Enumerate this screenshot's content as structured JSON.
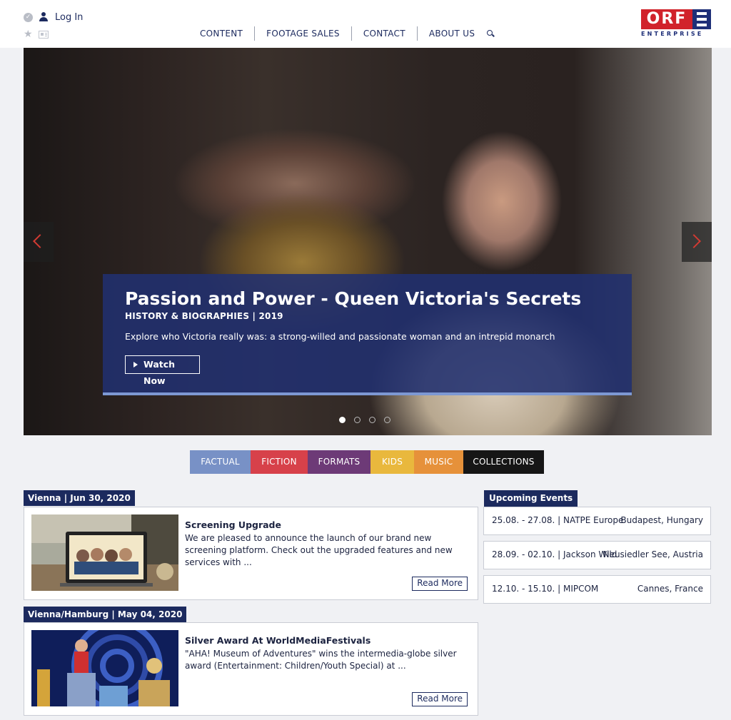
{
  "header": {
    "login_label": "Log In",
    "nav": [
      "CONTENT",
      "FOOTAGE SALES",
      "CONTACT",
      "ABOUT US"
    ],
    "logo_text": "ORF",
    "logo_sub": "ENTERPRISE"
  },
  "hero": {
    "title": "Passion and Power - Queen Victoria's Secrets",
    "meta": "HISTORY & BIOGRAPHIES | 2019",
    "description": "Explore who Victoria really was: a strong-willed and passionate woman and an intrepid monarch",
    "button": "Watch Now",
    "slide_count": 4,
    "active_slide": 1
  },
  "categories": [
    {
      "label": "FACTUAL",
      "color": "#7891c6"
    },
    {
      "label": "FICTION",
      "color": "#d7414a"
    },
    {
      "label": "FORMATS",
      "color": "#6d3a77"
    },
    {
      "label": "KIDS",
      "color": "#e9b83d"
    },
    {
      "label": "MUSIC",
      "color": "#e6913a"
    },
    {
      "label": "COLLECTIONS",
      "color": "#161616"
    }
  ],
  "news": [
    {
      "tag": "Vienna | Jun 30, 2020",
      "title": "Screening Upgrade",
      "text": "We are pleased to announce the launch of our brand new screening platform. Check out the upgraded features and new services with ...",
      "button": "Read More"
    },
    {
      "tag": "Vienna/Hamburg | May 04, 2020",
      "title": "Silver Award At WorldMediaFestivals",
      "text": "\"AHA! Museum of Adventures\" wins the intermedia-globe silver award (Entertainment: Children/Youth Special) at ...",
      "button": "Read More"
    }
  ],
  "events": {
    "title": "Upcoming Events",
    "items": [
      {
        "dates": "25.08. - 27.08. | NATPE Europe",
        "place": "Budapest, Hungary"
      },
      {
        "dates": "28.09. - 02.10. | Jackson Wild",
        "place": "Neusiedler See, Austria"
      },
      {
        "dates": "12.10. - 15.10. | MIPCOM",
        "place": "Cannes, France"
      }
    ]
  },
  "colors": {
    "brand_navy": "#1c2a5e",
    "brand_red": "#d1222b",
    "caption_bar": "#7d98d3"
  }
}
